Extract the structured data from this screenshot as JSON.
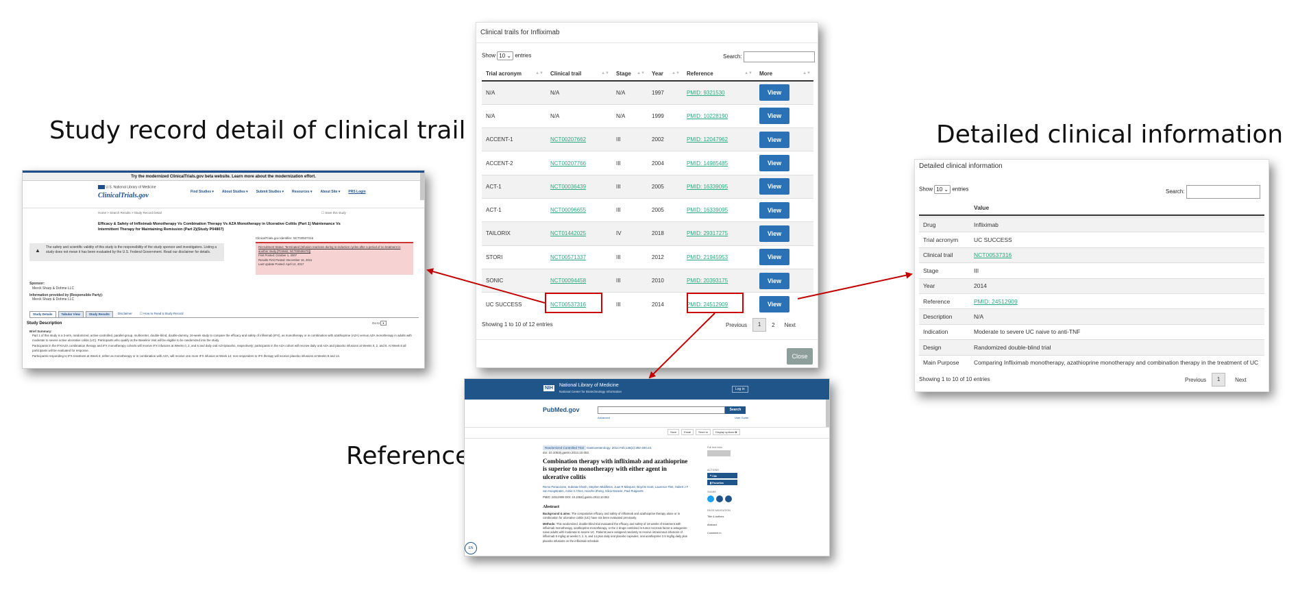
{
  "captions": {
    "left": "Study record detail of clinical trail",
    "right": "Detailed clinical information",
    "bottom": "Reference"
  },
  "modal": {
    "title": "Clinical trails for Infliximab",
    "show_label": "Show",
    "entries_value": "10",
    "entries_label": "entries",
    "search_label": "Search:",
    "columns": [
      "Trial acronym",
      "Clinical trail",
      "Stage",
      "Year",
      "Reference",
      "More"
    ],
    "rows": [
      {
        "acronym": "N/A",
        "trial": "N/A",
        "stage": "N/A",
        "year": "1997",
        "ref": "PMID: 9321530",
        "more": "View"
      },
      {
        "acronym": "N/A",
        "trial": "N/A",
        "stage": "N/A",
        "year": "1999",
        "ref": "PMID: 10228190",
        "more": "View"
      },
      {
        "acronym": "ACCENT-1",
        "trial": "NCT00207662",
        "stage": "III",
        "year": "2002",
        "ref": "PMID: 12047962",
        "more": "View"
      },
      {
        "acronym": "ACCENT-2",
        "trial": "NCT00207766",
        "stage": "III",
        "year": "2004",
        "ref": "PMID: 14985485",
        "more": "View"
      },
      {
        "acronym": "ACT-1",
        "trial": "NCT00036439",
        "stage": "III",
        "year": "2005",
        "ref": "PMID: 16339095",
        "more": "View"
      },
      {
        "acronym": "ACT-1",
        "trial": "NCT00096655",
        "stage": "III",
        "year": "2005",
        "ref": "PMID: 16339095",
        "more": "View"
      },
      {
        "acronym": "TAILORIX",
        "trial": "NCT01442025",
        "stage": "IV",
        "year": "2018",
        "ref": "PMID: 29317275",
        "more": "View"
      },
      {
        "acronym": "STORI",
        "trial": "NCT00571337",
        "stage": "III",
        "year": "2012",
        "ref": "PMID: 21945953",
        "more": "View"
      },
      {
        "acronym": "SONIC",
        "trial": "NCT00094458",
        "stage": "III",
        "year": "2010",
        "ref": "PMID: 20393175",
        "more": "View"
      },
      {
        "acronym": "UC SUCCESS",
        "trial": "NCT00537316",
        "stage": "III",
        "year": "2014",
        "ref": "PMID: 24512909",
        "more": "View"
      }
    ],
    "info": "Showing 1 to 10 of 12 entries",
    "prev": "Previous",
    "page1": "1",
    "page2": "2",
    "next": "Next",
    "close": "Close"
  },
  "detail": {
    "title": "Detailed clinical information",
    "show_label": "Show",
    "entries_value": "10",
    "entries_label": "entries",
    "search_label": "Search:",
    "value_header": "Value",
    "rows": [
      {
        "k": "Drug",
        "v": "Infliximab"
      },
      {
        "k": "Trial acronym",
        "v": "UC SUCCESS"
      },
      {
        "k": "Clinical trail",
        "v": "NCT00537316"
      },
      {
        "k": "Stage",
        "v": "III"
      },
      {
        "k": "Year",
        "v": "2014"
      },
      {
        "k": "Reference",
        "v": "PMID: 24512909"
      },
      {
        "k": "Description",
        "v": "N/A"
      },
      {
        "k": "Indication",
        "v": "Moderate to severe UC naive to anti-TNF"
      },
      {
        "k": "Design",
        "v": "Randomized double-blind trial"
      },
      {
        "k": "Main Purpose",
        "v": "Comparing Infliximab monotherapy, azathioprine monotherapy and combination therapy in the treatment of UC"
      }
    ],
    "info": "Showing 1 to 10 of 10 entries",
    "prev": "Previous",
    "page1": "1",
    "next": "Next"
  },
  "ctgov": {
    "banner": "Try the modernized ClinicalTrials.gov beta website. Learn more about the modernization effort.",
    "nlm": "U.S. National Library of Medicine",
    "logo": "ClinicalTrials.gov",
    "nav": [
      "Find Studies ▾",
      "About Studies ▾",
      "Submit Studies ▾",
      "Resources ▾",
      "About Site ▾",
      "PRS Login"
    ],
    "breadcrumb": "Home > Search Results > Study Record Detail",
    "save": "Save this study",
    "study_title": "Efficacy & Safety of Infliximab Monotherapy Vs Combination Therapy Vs AZA Monotherapy in Ulcerative Colitis (Part 1) Maintenance Vs Intermittent Therapy for Maintaining Remission (Part 2)(Study P04807)",
    "warning": "The safety and scientific validity of this study is the responsibility of the study sponsor and investigators. Listing a study does not mean it has been evaluated by the U.S. Federal Government. Read our disclaimer for details.",
    "identifier": "ClinicalTrials.gov Identifier: NCT00537316",
    "status_lines": [
      "Recruitment Status: Terminated (Infusion reactions during re-induction cycles after a period of no treatment in another study [P04662; NCT00536270])",
      "First Posted: October 1, 2007",
      "Results First Posted: December 16, 2011",
      "Last Update Posted: April 12, 2017"
    ],
    "sponsor_label": "Sponsor:",
    "sponsor": "Merck Sharp & Dohme LLC",
    "info_label": "Information provided by (Responsible Party):",
    "info_party": "Merck Sharp & Dohme LLC",
    "tabs": [
      "Study Details",
      "Tabular View",
      "Study Results",
      "Disclaimer",
      "How to Read a Study Record"
    ],
    "section": "Study Description",
    "goto": "Go to",
    "brief": "Brief Summary:",
    "paras": [
      "Part 1 of this study is a 3-arm, randomized, active-controlled, parallel-group, multicenter, double-blind, double-dummy, 16-week study to compare the efficacy and safety of infliximab (IFX), as monotherapy or in combination with azathioprine (AZA) versus AZA monotherapy in adults with moderate to severe active ulcerative colitis (UC). Participants who qualify at the Baseline Visit will be eligible to be randomized into the study.",
      "Participants in the IFX/AZA combination therapy and IFX monotherapy cohorts will receive IFX infusions at Weeks 0, 2, and 6 and daily oral AZA/placebo, respectively; participants in the AZA cohort will receive daily oral AZA and placebo infusions at Weeks 0, 2, and 6. At Week 8 all participants will be evaluated for response.",
      "Participants responding to IFX treatment at Week 8, either as monotherapy or in combination with AZA, will receive one more IFX infusion at Week 14; non-responders to IFX therapy will receive placebo infusions at Weeks 8 and 14."
    ]
  },
  "pubmed": {
    "nlm": "National Library of Medicine",
    "ncbi": "National Center for Biotechnology Information",
    "login": "Log in",
    "logo": "PubMed.gov",
    "search_btn": "Search",
    "advanced": "Advanced",
    "user_guide": "User Guide",
    "actions": [
      "Save",
      "Email",
      "Send to",
      "Display options ✿"
    ],
    "tag": "Randomized Controlled Trial",
    "journal": "Gastroenterology. 2014 Feb;146(2):392-400.e3.",
    "doi": "doi: 10.1053/j.gastro.2013.10.052.",
    "title": "Combination therapy with infliximab and azathioprine is superior to monotherapy with either agent in ulcerative colitis",
    "authors": "Remo Panaccione, Subrata Ghosh, Stephen Middleton, Juan R Márquez, Boyd B Scott, Laurence Flint, Hubert J F van Hoogstraten, Annie C Chen, Hanzhe Zheng, Silvio Danese, Paul Rutgeerts",
    "pmid": "PMID: 24512909   DOI: 10.1053/j.gastro.2013.10.052",
    "abstract": "Abstract",
    "bg_label": "Background & aims:",
    "bg": "The comparative efficacy and safety of infliximab and azathioprine therapy alone or in combination for ulcerative colitis (UC) have not been evaluated previously.",
    "m_label": "Methods:",
    "methods": "This randomized, double-blind trial evaluated the efficacy and safety of 16 weeks of treatment with infliximab monotherapy, azathioprine monotherapy, or the 2 drugs combined in tumor necrosis factor-α antagonist-naive adults with moderate to severe UC. Patients were assigned randomly to receive intravenous infusions of infliximab 5 mg/kg at weeks 0, 2, 6, and 14 plus daily oral placebo capsules, oral azathioprine 2.5 mg/kg daily plus placebo infusions on the infliximab schedule",
    "side_fulltext": "Full text links",
    "side_actions": "ACTIONS",
    "cite": "Cite",
    "favorites": "Favorites",
    "share": "SHARE",
    "page_nav": "PAGE NAVIGATION",
    "nav_items": [
      "Title & authors",
      "Abstract",
      "Comment in"
    ],
    "lang": "EN"
  },
  "colors": {
    "link": "#2aa880",
    "view_btn": "#2a72b5",
    "arrow": "#c00000",
    "pubmed_header": "#20558a"
  }
}
